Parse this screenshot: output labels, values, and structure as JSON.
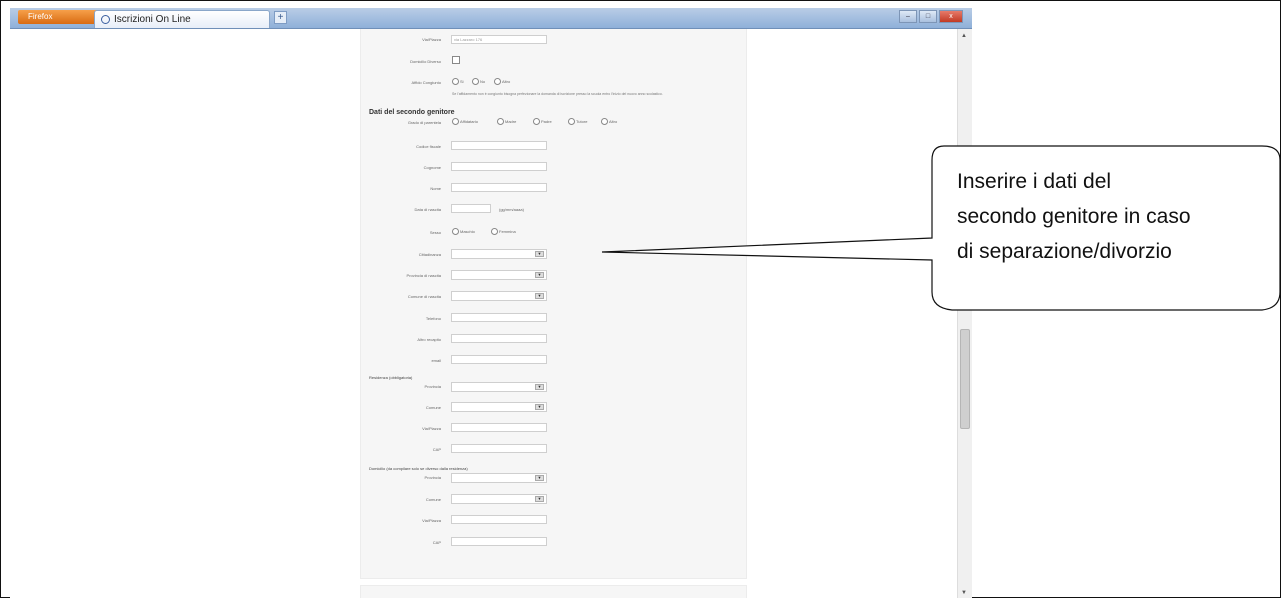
{
  "browser": {
    "firefox_button": "Firefox",
    "tab_title": "Iscrizioni On Line",
    "new_tab": "+",
    "win_min": "–",
    "win_max": "□",
    "win_close": "x"
  },
  "form": {
    "top": {
      "via_label": "Via/Piazza",
      "via_value": "via Lazzaro 176",
      "domicilio_label": "Domicilio Diverso",
      "straniero_label": "Affido Congiunto",
      "straniero_options": [
        "Si",
        "No",
        "Altro"
      ],
      "note_text": "Se l'affidamento non è congiunto bisogna perfezionare la domanda di iscrizione presso la scuola entro l'inizio del nuovo anno scolastico."
    },
    "section_title": "Dati del secondo genitore",
    "grado_label": "Grado di parentela",
    "grado_options": [
      "Affidatario",
      "Madre",
      "Padre",
      "Tutore",
      "Altro"
    ],
    "fields": [
      {
        "label": "Codice fiscale",
        "type": "text"
      },
      {
        "label": "Cognome",
        "type": "text"
      },
      {
        "label": "Nome",
        "type": "text"
      },
      {
        "label": "Data di nascita",
        "type": "date",
        "hint": "(gg/mm/aaaa)"
      }
    ],
    "sesso_label": "Sesso",
    "sesso_options": [
      "Maschio",
      "Femmina"
    ],
    "selects": [
      {
        "label": "Cittadinanza"
      },
      {
        "label": "Provincia di nascita"
      },
      {
        "label": "Comune di nascita"
      }
    ],
    "fields2": [
      {
        "label": "Telefono"
      },
      {
        "label": "Altro recapito"
      },
      {
        "label": "email"
      }
    ],
    "residenza": {
      "title": "Residenza (obbligatoria)",
      "provincia": "Provincia",
      "comune": "Comune",
      "via": "Via/Piazza",
      "cap": "CAP"
    },
    "domicilio": {
      "title": "Domicilio (da compilare solo se diverso dalla residenza)",
      "provincia": "Provincia",
      "comune": "Comune",
      "via": "Via/Piazza",
      "cap": "CAP"
    }
  },
  "callout": {
    "line1": "Inserire i dati del",
    "line2": "secondo genitore in caso",
    "line3": "di separazione/divorzio"
  }
}
